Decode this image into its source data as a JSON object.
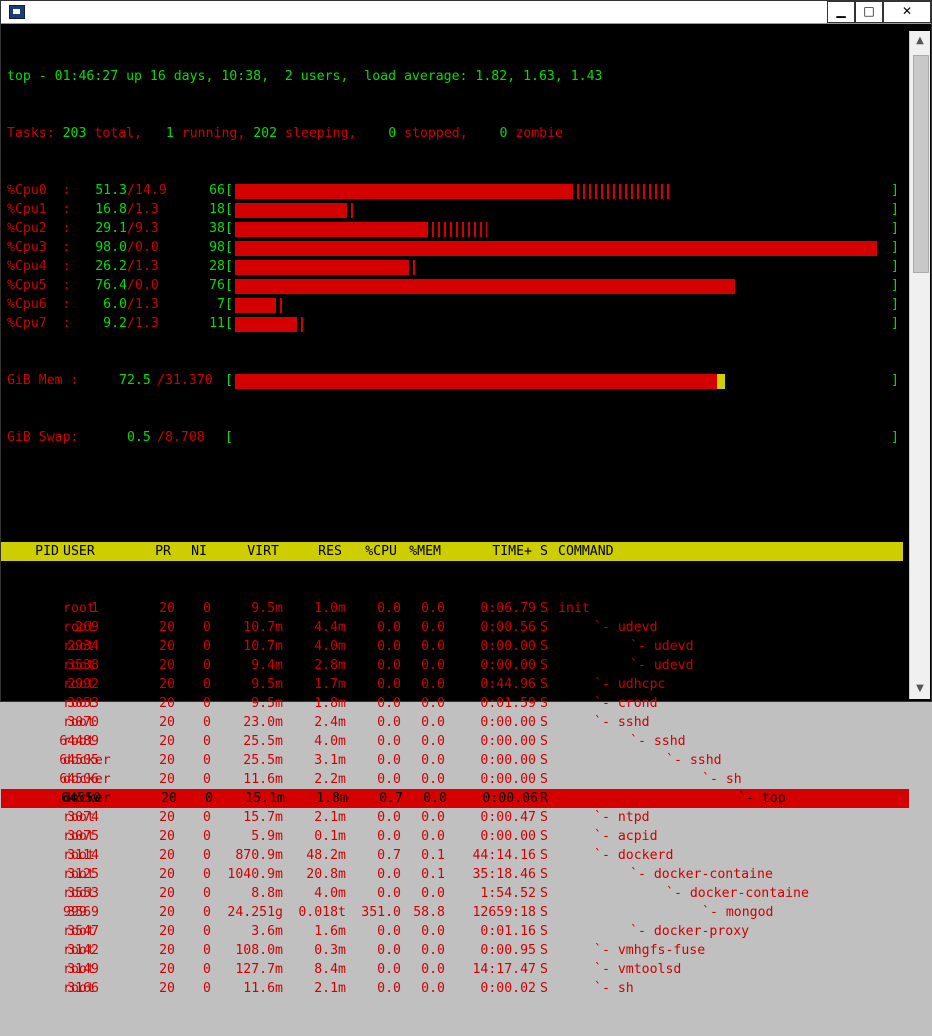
{
  "window": {
    "title": "",
    "controls": {
      "minimize": "▁",
      "maximize": "□",
      "close": "✕"
    },
    "icon": "terminal-app-icon"
  },
  "summary": {
    "uptime_line": "top - 01:46:27 up 16 days, 10:38,  2 users,  load average: 1.82, 1.63, 1.43",
    "tasks_prefix": "Tasks:",
    "tasks_total": "203",
    "tasks_total_label": "total,",
    "tasks_running": "1",
    "tasks_running_label": "running,",
    "tasks_sleeping": "202",
    "tasks_sleeping_label": "sleeping,",
    "tasks_stopped": "0",
    "tasks_stopped_label": "stopped,",
    "tasks_zombie": "0",
    "tasks_zombie_label": "zombie"
  },
  "cpus": [
    {
      "label": "%Cpu0  :",
      "us": "51.3",
      "sy": "14.9",
      "total": "66",
      "fill": 0.513,
      "tick": 0.149
    },
    {
      "label": "%Cpu1  :",
      "us": "16.8",
      "sy": "1.3",
      "total": "18",
      "fill": 0.168,
      "tick": 0.013
    },
    {
      "label": "%Cpu2  :",
      "us": "29.1",
      "sy": "9.3",
      "total": "38",
      "fill": 0.291,
      "tick": 0.093
    },
    {
      "label": "%Cpu3  :",
      "us": "98.0",
      "sy": "0.0",
      "total": "98",
      "fill": 0.98,
      "tick": 0.0
    },
    {
      "label": "%Cpu4  :",
      "us": "26.2",
      "sy": "1.3",
      "total": "28",
      "fill": 0.262,
      "tick": 0.013
    },
    {
      "label": "%Cpu5  :",
      "us": "76.4",
      "sy": "0.0",
      "total": "76",
      "fill": 0.764,
      "tick": 0.0
    },
    {
      "label": "%Cpu6  :",
      "us": "6.0",
      "sy": "1.3",
      "total": "7",
      "fill": 0.06,
      "tick": 0.013
    },
    {
      "label": "%Cpu7  :",
      "us": "9.2",
      "sy": "1.3",
      "total": "11",
      "fill": 0.092,
      "tick": 0.013
    }
  ],
  "mem": {
    "label": "GiB Mem :",
    "used": "72.5",
    "total": "31.370",
    "fill": 0.725
  },
  "swap": {
    "label": "GiB Swap:",
    "used": "0.5",
    "total": "8.708",
    "fill": 0.0
  },
  "columns": [
    "PID",
    "USER",
    "PR",
    "NI",
    "VIRT",
    "RES",
    "%CPU",
    "%MEM",
    "TIME+",
    "S",
    "COMMAND"
  ],
  "processes": [
    {
      "pid": "1",
      "user": "root",
      "pr": "20",
      "ni": "0",
      "virt": "9.5m",
      "res": "1.0m",
      "cpu": "0.0",
      "mem": "0.0",
      "time": "0:06.79",
      "s": "S",
      "cmd": "init",
      "indent": 0
    },
    {
      "pid": "269",
      "user": "root",
      "pr": "20",
      "ni": "0",
      "virt": "10.7m",
      "res": "4.4m",
      "cpu": "0.0",
      "mem": "0.0",
      "time": "0:00.56",
      "s": "S",
      "cmd": "`- udevd",
      "indent": 1
    },
    {
      "pid": "2934",
      "user": "root",
      "pr": "20",
      "ni": "0",
      "virt": "10.7m",
      "res": "4.0m",
      "cpu": "0.0",
      "mem": "0.0",
      "time": "0:00.00",
      "s": "S",
      "cmd": "`- udevd",
      "indent": 2
    },
    {
      "pid": "3538",
      "user": "root",
      "pr": "20",
      "ni": "0",
      "virt": "9.4m",
      "res": "2.8m",
      "cpu": "0.0",
      "mem": "0.0",
      "time": "0:00.00",
      "s": "S",
      "cmd": "`- udevd",
      "indent": 2
    },
    {
      "pid": "2992",
      "user": "root",
      "pr": "20",
      "ni": "0",
      "virt": "9.5m",
      "res": "1.7m",
      "cpu": "0.0",
      "mem": "0.0",
      "time": "0:44.96",
      "s": "S",
      "cmd": "`- udhcpc",
      "indent": 1
    },
    {
      "pid": "3053",
      "user": "root",
      "pr": "20",
      "ni": "0",
      "virt": "9.5m",
      "res": "1.8m",
      "cpu": "0.0",
      "mem": "0.0",
      "time": "0:01.59",
      "s": "S",
      "cmd": "`- crond",
      "indent": 1
    },
    {
      "pid": "3070",
      "user": "root",
      "pr": "20",
      "ni": "0",
      "virt": "23.0m",
      "res": "2.4m",
      "cpu": "0.0",
      "mem": "0.0",
      "time": "0:00.00",
      "s": "S",
      "cmd": "`- sshd",
      "indent": 1
    },
    {
      "pid": "64489",
      "user": "root",
      "pr": "20",
      "ni": "0",
      "virt": "25.5m",
      "res": "4.0m",
      "cpu": "0.0",
      "mem": "0.0",
      "time": "0:00.00",
      "s": "S",
      "cmd": "`- sshd",
      "indent": 2
    },
    {
      "pid": "64505",
      "user": "docker",
      "pr": "20",
      "ni": "0",
      "virt": "25.5m",
      "res": "3.1m",
      "cpu": "0.0",
      "mem": "0.0",
      "time": "0:00.00",
      "s": "S",
      "cmd": "`- sshd",
      "indent": 3
    },
    {
      "pid": "64506",
      "user": "docker",
      "pr": "20",
      "ni": "0",
      "virt": "11.6m",
      "res": "2.2m",
      "cpu": "0.0",
      "mem": "0.0",
      "time": "0:00.00",
      "s": "S",
      "cmd": "`- sh",
      "indent": 4
    },
    {
      "pid": "64550",
      "user": "docker",
      "pr": "20",
      "ni": "0",
      "virt": "15.1m",
      "res": "1.8m",
      "cpu": "0.7",
      "mem": "0.0",
      "time": "0:00.06",
      "s": "R",
      "cmd": "`- top",
      "indent": 5,
      "selected": true
    },
    {
      "pid": "3074",
      "user": "root",
      "pr": "20",
      "ni": "0",
      "virt": "15.7m",
      "res": "2.1m",
      "cpu": "0.0",
      "mem": "0.0",
      "time": "0:00.47",
      "s": "S",
      "cmd": "`- ntpd",
      "indent": 1
    },
    {
      "pid": "3075",
      "user": "root",
      "pr": "20",
      "ni": "0",
      "virt": "5.9m",
      "res": "0.1m",
      "cpu": "0.0",
      "mem": "0.0",
      "time": "0:00.00",
      "s": "S",
      "cmd": "`- acpid",
      "indent": 1
    },
    {
      "pid": "3114",
      "user": "root",
      "pr": "20",
      "ni": "0",
      "virt": "870.9m",
      "res": "48.2m",
      "cpu": "0.7",
      "mem": "0.1",
      "time": "44:14.16",
      "s": "S",
      "cmd": "`- dockerd",
      "indent": 1
    },
    {
      "pid": "3125",
      "user": "root",
      "pr": "20",
      "ni": "0",
      "virt": "1040.9m",
      "res": "20.8m",
      "cpu": "0.0",
      "mem": "0.1",
      "time": "35:18.46",
      "s": "S",
      "cmd": "`- docker-containe",
      "indent": 2
    },
    {
      "pid": "3553",
      "user": "root",
      "pr": "20",
      "ni": "0",
      "virt": "8.8m",
      "res": "4.0m",
      "cpu": "0.0",
      "mem": "0.0",
      "time": "1:54.52",
      "s": "S",
      "cmd": "`- docker-containe",
      "indent": 3
    },
    {
      "pid": "3569",
      "user": "999",
      "pr": "20",
      "ni": "0",
      "virt": "24.251g",
      "res": "0.018t",
      "cpu": "351.0",
      "mem": "58.8",
      "time": "12659:18",
      "s": "S",
      "cmd": "`- mongod",
      "indent": 4
    },
    {
      "pid": "3547",
      "user": "root",
      "pr": "20",
      "ni": "0",
      "virt": "3.6m",
      "res": "1.6m",
      "cpu": "0.0",
      "mem": "0.0",
      "time": "0:01.16",
      "s": "S",
      "cmd": "`- docker-proxy",
      "indent": 2
    },
    {
      "pid": "3142",
      "user": "root",
      "pr": "20",
      "ni": "0",
      "virt": "108.0m",
      "res": "0.3m",
      "cpu": "0.0",
      "mem": "0.0",
      "time": "0:00.95",
      "s": "S",
      "cmd": "`- vmhgfs-fuse",
      "indent": 1
    },
    {
      "pid": "3149",
      "user": "root",
      "pr": "20",
      "ni": "0",
      "virt": "127.7m",
      "res": "8.4m",
      "cpu": "0.0",
      "mem": "0.0",
      "time": "14:17.47",
      "s": "S",
      "cmd": "`- vmtoolsd",
      "indent": 1
    },
    {
      "pid": "3166",
      "user": "root",
      "pr": "20",
      "ni": "0",
      "virt": "11.6m",
      "res": "2.1m",
      "cpu": "0.0",
      "mem": "0.0",
      "time": "0:00.02",
      "s": "S",
      "cmd": "`- sh",
      "indent": 1
    }
  ],
  "colors": {
    "fg": "#d00000",
    "green": "#00e000",
    "header_bg": "#cdcd00",
    "selected_bg": "#d40000",
    "mem_cap": "#d0d000"
  }
}
